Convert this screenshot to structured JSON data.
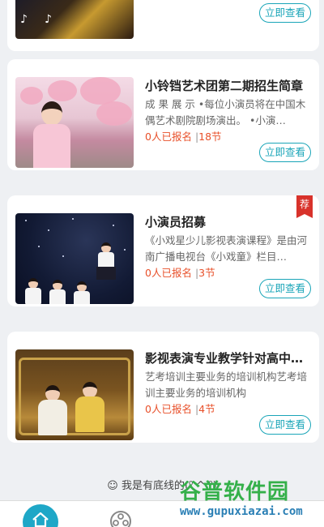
{
  "courses": [
    {
      "title": "",
      "desc": "",
      "enrolled": "",
      "lessons": "",
      "button": "立即查看",
      "recommended": false
    },
    {
      "title": "小铃铛艺术团第二期招生简章",
      "desc": "成 果 展 示 •每位小演员将在中国木偶艺术剧院剧场演出。  •小演…",
      "enrolled": "0人已报名",
      "separator": "|",
      "lessons": "18节",
      "button": "立即查看",
      "recommended": false
    },
    {
      "title": "小演员招募",
      "desc": "《小戏星少儿影视表演课程》是由河南广播电视台《小戏童》栏目…",
      "enrolled": "0人已报名",
      "separator": "|",
      "lessons": "3节",
      "button": "立即查看",
      "recommended": true,
      "badge": "荐"
    },
    {
      "title": "影视表演专业教学针对高中…",
      "desc": "艺考培训主要业务的培训机构艺考培训主要业务的培训机构",
      "enrolled": "0人已报名",
      "separator": "|",
      "lessons": "4节",
      "button": "立即查看",
      "recommended": false
    }
  ],
  "footer": {
    "no_more": "☺ 我是有底线的(⁰ ^ ⁰)"
  },
  "watermark": {
    "title": "谷普软件园",
    "url": "www.gupuxiazai.com"
  },
  "colors": {
    "accent": "#1aa5b8",
    "price": "#e8502a",
    "badge": "#d8322b",
    "tab_active": "#1ea7c7"
  },
  "icons": [
    "home-icon",
    "film-reel-icon"
  ]
}
